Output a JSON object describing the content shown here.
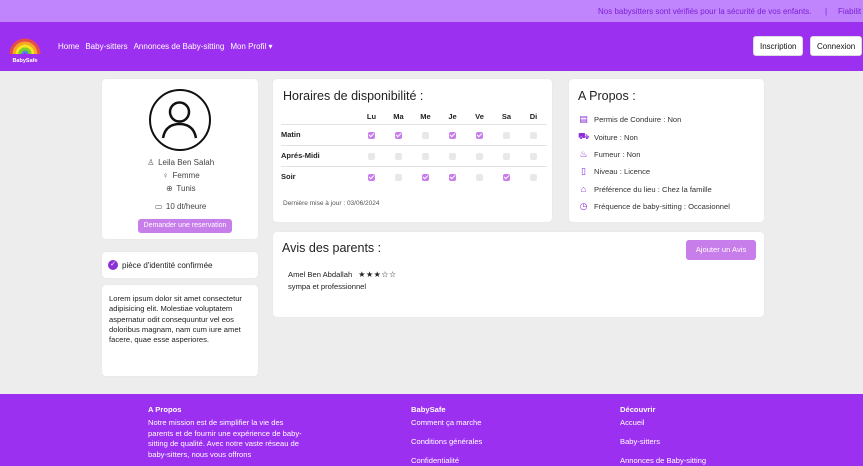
{
  "topbar": {
    "message": "Nos babysitters sont vérifiés pour la sécurité de vos enfants.",
    "separator": "|",
    "cut_link": "Fiabilit"
  },
  "nav": {
    "logo_text": "BabySafe",
    "links": [
      "Home",
      "Baby-sitters",
      "Annonces de Baby-sitting",
      "Mon Profil ▾"
    ],
    "register": "Inscription",
    "login": "Connexion"
  },
  "profile": {
    "name": "Leila Ben Salah",
    "gender": "Femme",
    "city": "Tunis",
    "rate": "10 dt/heure",
    "reserve_button": "Demander une reservation",
    "verified": "pièce d'identité confirmée",
    "bio": "Lorem ipsum dolor sit amet consectetur adipisicing elit. Molestiae voluptatem aspernatur odit consequuntur vel eos doloribus magnam, nam cum iure amet facere, quae esse asperiores."
  },
  "schedule": {
    "title": "Horaires de disponibilité :",
    "days": [
      "Lu",
      "Ma",
      "Me",
      "Je",
      "Ve",
      "Sa",
      "Di"
    ],
    "rows": [
      {
        "label": "Matin",
        "slots": [
          true,
          true,
          false,
          true,
          true,
          false,
          false
        ]
      },
      {
        "label": "Aprés-Midi",
        "slots": [
          false,
          false,
          false,
          false,
          false,
          false,
          false
        ]
      },
      {
        "label": "Soir",
        "slots": [
          true,
          false,
          true,
          true,
          false,
          true,
          false
        ]
      }
    ],
    "updated": "Dernière mise à jour : 03/06/2024"
  },
  "about": {
    "title": "A Propos :",
    "items": [
      {
        "icon": "id-card-icon",
        "text": "Permis de Conduire : Non"
      },
      {
        "icon": "car-icon",
        "text": "Voiture : Non"
      },
      {
        "icon": "fire-icon",
        "text": "Fumeur : Non"
      },
      {
        "icon": "book-icon",
        "text": "Niveau : Licence"
      },
      {
        "icon": "house-icon",
        "text": "Préférence du lieu : Chez la famille"
      },
      {
        "icon": "clock-icon",
        "text": "Fréquence de baby-sitting : Occasionnel"
      }
    ]
  },
  "reviews": {
    "title": "Avis des parents :",
    "add_button": "Ajouter un Avis",
    "items": [
      {
        "author": "Amel Ben Abdallah",
        "rating": 3,
        "stars": "★★★☆☆",
        "text": "sympa et professionnel"
      }
    ]
  },
  "footer": {
    "col1": {
      "title": "A Propos",
      "text": "Notre mission est de simplifier la vie des parents et de fournir une expérience de baby-sitting de qualité. Avec notre vaste réseau de baby-sitters, nous vous offrons"
    },
    "col2": {
      "title": "BabySafe",
      "links": [
        "Comment ça marche",
        "Conditions générales",
        "Confidentialité"
      ]
    },
    "col3": {
      "title": "Découvrir",
      "links": [
        "Accueil",
        "Baby-sitters",
        "Annonces de Baby-sitting"
      ]
    }
  },
  "colors": {
    "primary": "#9b30f0",
    "topbar": "#c084fc",
    "accent": "#c77dea"
  }
}
